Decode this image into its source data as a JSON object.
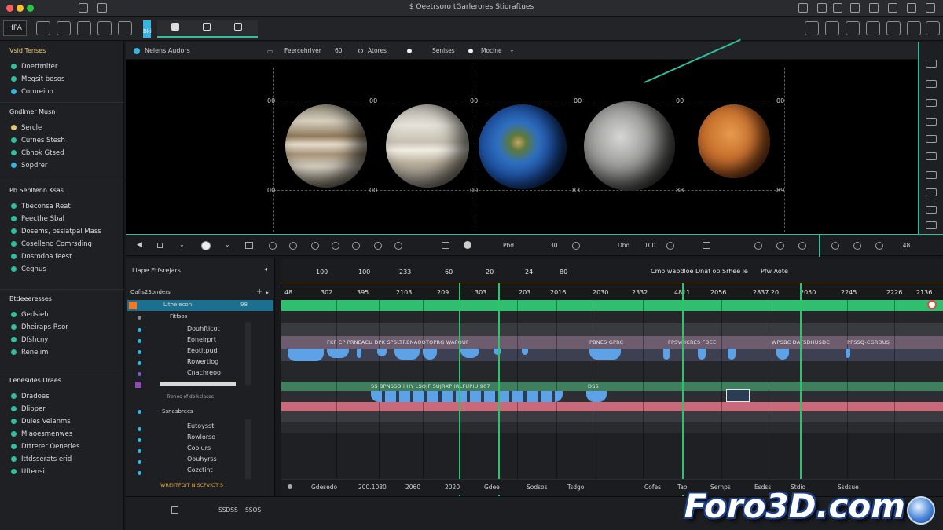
{
  "window": {
    "title": "$ Oeetrsoro tGarlerores Stioraftues"
  },
  "toolbar": {
    "app_label": "HPA",
    "tab_label": "Bki"
  },
  "sidebar": {
    "sections": [
      {
        "title": "Vsld Tenses",
        "items": [
          {
            "label": "Doettmiter",
            "color": "#2fbf9f"
          },
          {
            "label": "Megsit bosos",
            "color": "#2fbf9f"
          },
          {
            "label": "Comreion",
            "color": "#36b5e0"
          }
        ]
      },
      {
        "title": "Gndlmer Musn",
        "items": [
          {
            "label": "Sercle",
            "color": "#e9c46a"
          },
          {
            "label": "Cufnes Stesh",
            "color": "#2fbf9f"
          },
          {
            "label": "Cbnok Gtsed",
            "color": "#2fbf9f"
          },
          {
            "label": "Sopdrer",
            "color": "#36b5e0"
          }
        ]
      },
      {
        "title": "Pb Sepltenn Ksas",
        "items": [
          {
            "label": "Tbeconsa Reat",
            "color": "#2fbf9f"
          },
          {
            "label": "Peecthe Sbal",
            "color": "#2fbf9f"
          },
          {
            "label": "Dosems, bsslatpal Mass",
            "color": "#2fbf9f"
          },
          {
            "label": "Coselleno Comrsding",
            "color": "#2fbf9f"
          },
          {
            "label": "Dosrodoa feest",
            "color": "#2fbf9f"
          },
          {
            "label": "Cegnus",
            "color": "#2fbf9f"
          }
        ]
      },
      {
        "title": "Btdeeeresses",
        "items": [
          {
            "label": "Gedsieh",
            "color": "#2fbf9f"
          },
          {
            "label": "Dheiraps Rsor",
            "color": "#2fbf9f"
          },
          {
            "label": "Dfshcny",
            "color": "#2fbf9f"
          },
          {
            "label": "Reneiim",
            "color": "#2fbf9f"
          }
        ]
      },
      {
        "title": "Lenesides Oraes",
        "items": [
          {
            "label": "Dradoes",
            "color": "#2fbf9f"
          },
          {
            "label": "Dlipper",
            "color": "#2fbf9f"
          },
          {
            "label": "Dules Velanms",
            "color": "#2fbf9f"
          },
          {
            "label": "Mlaoesmenwes",
            "color": "#2fbf9f"
          },
          {
            "label": "Dttrerer Oeneries",
            "color": "#2fbf9f"
          },
          {
            "label": "Ittdsserats erid",
            "color": "#2fbf9f"
          },
          {
            "label": "Uftensi",
            "color": "#2fbf9f"
          }
        ]
      }
    ]
  },
  "viewer": {
    "head_title": "Nelens Audors",
    "head_items": [
      "Feercehriver",
      "60",
      "Atores",
      "Senises",
      "Mocine"
    ],
    "grid_labels": [
      "00",
      "00",
      "00",
      "00",
      "00",
      "00",
      "00",
      "00",
      "00",
      "83",
      "88",
      "89"
    ],
    "controls": [
      "Pbd",
      "30",
      "Dbd",
      "100",
      "148"
    ]
  },
  "layers": {
    "title": "Llape Etfsrejars",
    "group_label": "Oafis2Sonders",
    "selected": "Lithelecon",
    "selected_badge": "98",
    "rows_a": [
      "Fitfsos",
      "Douhfticot",
      "Eoneirprt",
      "Eeotitpud",
      "Rowertiog",
      "Cnachreoo"
    ],
    "row_mid": "Trenes of dolkslasos",
    "sub_title": "Ssnasbrecs",
    "rows_b": [
      "Eutoysst",
      "Rowlorso",
      "Coolurs",
      "Oouhyrss",
      "Cozctint"
    ],
    "bottom": "WREIITFOIT NISCFV:OT'S"
  },
  "timeline": {
    "header_numbers": [
      "100",
      "100",
      "233",
      "60",
      "20",
      "24",
      "80"
    ],
    "header_right": "Cmo wabdloe Dnaf op Srhee le",
    "header_right2": "Pfw Aote",
    "ruler": [
      "48",
      "302",
      "395",
      "2103",
      "209",
      "303",
      "203",
      "2016",
      "2030",
      "2332",
      "4811",
      "2056",
      "2837.20",
      "2050",
      "2245",
      "2226",
      "2136"
    ],
    "lane_labels": [
      "FKF CP PRNEACU DPK SPSLTRBNAOOTOPRG WAFOUF",
      "PBNES GPRC",
      "FPSVPICRES FDEE",
      "WPSBC DAFSDHUSDC",
      "PPSSQ-CGRDUS"
    ],
    "lane_labels2": [
      "SS BPNSSO i HY LSOJF SUJRXP IRLFUPIU 907",
      "DSS"
    ],
    "bottom": [
      "Gdesedo",
      "200.1080",
      "2060",
      "2020",
      "Gdee",
      "Sodsos",
      "Tsdgo",
      "Cofes",
      "Tao",
      "Sernps",
      "Esdss",
      "Stdio",
      "Ssdsue"
    ]
  },
  "bottombar": {
    "items": [
      "SSDSS",
      "SSOS"
    ]
  },
  "watermark": "Foro3D.com"
}
